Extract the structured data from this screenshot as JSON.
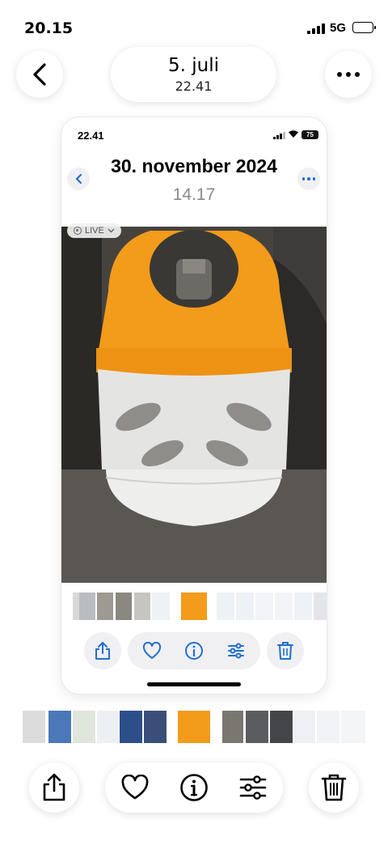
{
  "status_bar": {
    "time": "20.15",
    "network": "5G"
  },
  "header": {
    "date": "5. juli",
    "time": "22.41"
  },
  "inner": {
    "status_time": "22.41",
    "battery": "75",
    "date": "30. november 2024",
    "time": "14.17",
    "live_label": "LIVE"
  },
  "icons": {
    "back": "chevron-left-icon",
    "more": "ellipsis-icon",
    "share": "share-icon",
    "favorite": "heart-icon",
    "info": "info-icon",
    "adjust": "sliders-icon",
    "delete": "trash-icon"
  },
  "colors": {
    "accent": "#1f6fd1",
    "cylinder_top": "#f39b1b",
    "cylinder_base": "#e6e6e6"
  }
}
